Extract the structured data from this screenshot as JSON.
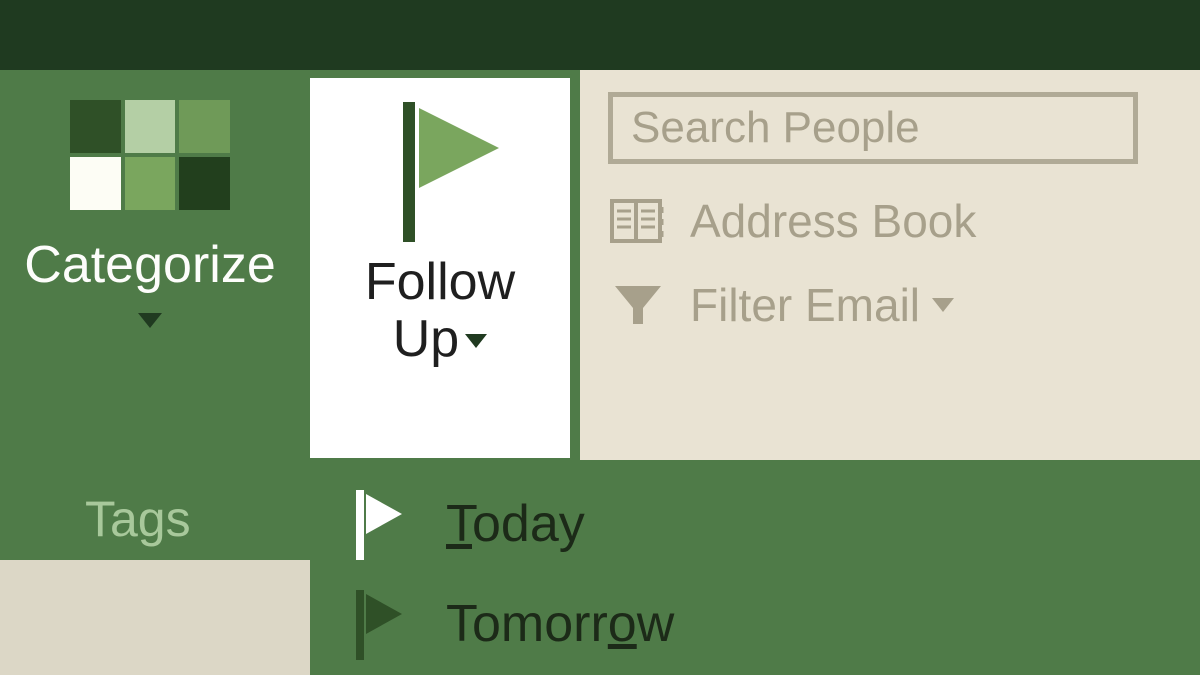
{
  "ribbon": {
    "categorize_label": "Categorize",
    "followup_label_line1": "Follow",
    "followup_label_line2": "Up",
    "group_label": "Tags"
  },
  "search": {
    "placeholder": "Search People"
  },
  "right_panel": {
    "address_book": "Address Book",
    "filter_email": "Filter Email"
  },
  "dropdown": {
    "items": [
      {
        "label": "Today",
        "accel_index": 0
      },
      {
        "label": "Tomorrow",
        "accel_index": 6
      }
    ]
  },
  "colors": {
    "dark_green": "#1f3a20",
    "mid_green": "#4f7b48",
    "light_green": "#7aa65e",
    "pale_green": "#b4cfa5",
    "deep_green": "#2f5027",
    "cream": "#e9e3d3",
    "muted": "#a7a08b"
  }
}
